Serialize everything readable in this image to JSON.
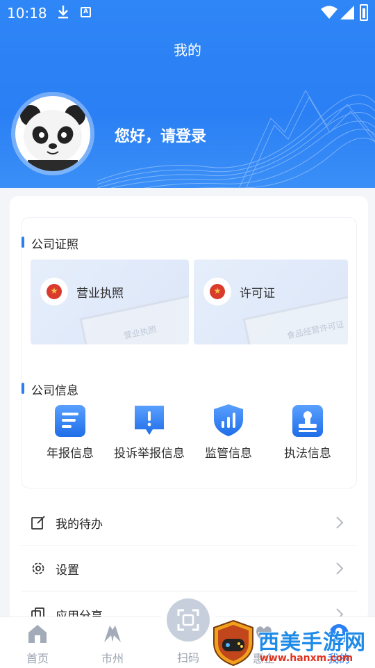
{
  "status_bar": {
    "time": "10:18",
    "icons": [
      "download-icon",
      "app-a-icon",
      "wifi-icon",
      "signal-icon",
      "battery-icon"
    ]
  },
  "header": {
    "title": "我的"
  },
  "profile": {
    "greeting": "您好，请登录",
    "avatar": "panda-avatar"
  },
  "company_license": {
    "title": "公司证照",
    "items": [
      {
        "label": "营业执照",
        "paper_text": "营业执照"
      },
      {
        "label": "许可证",
        "paper_text": "食品经营许可证"
      }
    ]
  },
  "company_info": {
    "title": "公司信息",
    "items": [
      {
        "label": "年报信息",
        "icon": "report-icon"
      },
      {
        "label": "投诉举报信息",
        "icon": "complaint-icon"
      },
      {
        "label": "监管信息",
        "icon": "supervision-icon"
      },
      {
        "label": "执法信息",
        "icon": "enforcement-icon"
      }
    ]
  },
  "menu": [
    {
      "label": "我的待办",
      "icon": "edit-icon"
    },
    {
      "label": "设置",
      "icon": "gear-icon"
    },
    {
      "label": "应用分享",
      "icon": "share-icon"
    }
  ],
  "bottom_nav": {
    "items": [
      {
        "label": "首页",
        "icon": "home-icon"
      },
      {
        "label": "市州",
        "icon": "city-icon"
      },
      {
        "label": "扫码",
        "icon": "scan-icon"
      },
      {
        "label": "惠企",
        "icon": "enterprise-icon"
      },
      {
        "label": "我的",
        "icon": "profile-icon",
        "active": true
      }
    ]
  },
  "watermark": {
    "brand": "西美手游网",
    "url": "www.hanxm.com"
  },
  "colors": {
    "primary": "#2a7ff4",
    "nav_inactive": "#9aa3b0",
    "text": "#222222"
  }
}
